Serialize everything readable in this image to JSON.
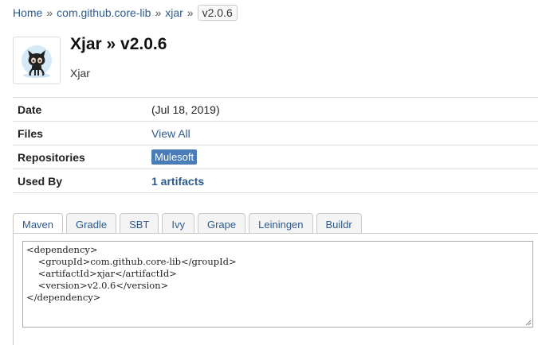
{
  "breadcrumb": {
    "home": "Home",
    "sep1": "»",
    "group": "com.github.core-lib",
    "sep2": "»",
    "artifact": "xjar",
    "sep3": "»",
    "version": "v2.0.6"
  },
  "header": {
    "title": "Xjar » v2.0.6",
    "subtitle": "Xjar",
    "logo_icon": "github-octocat-icon"
  },
  "info": {
    "date_label": "Date",
    "date_value": "(Jul 18, 2019)",
    "files_label": "Files",
    "files_value": "View All",
    "repos_label": "Repositories",
    "repos_value": "Mulesoft",
    "usedby_label": "Used By",
    "usedby_value": "1 artifacts"
  },
  "tabs": {
    "maven": "Maven",
    "gradle": "Gradle",
    "sbt": "SBT",
    "ivy": "Ivy",
    "grape": "Grape",
    "leiningen": "Leiningen",
    "buildr": "Buildr"
  },
  "snippet": {
    "code": "<dependency>\n    <groupId>com.github.core-lib</groupId>\n    <artifactId>xjar</artifactId>\n    <version>v2.0.6</version>\n</dependency>"
  },
  "colors": {
    "link": "#2d5a8f",
    "badge": "#4a7db8"
  }
}
